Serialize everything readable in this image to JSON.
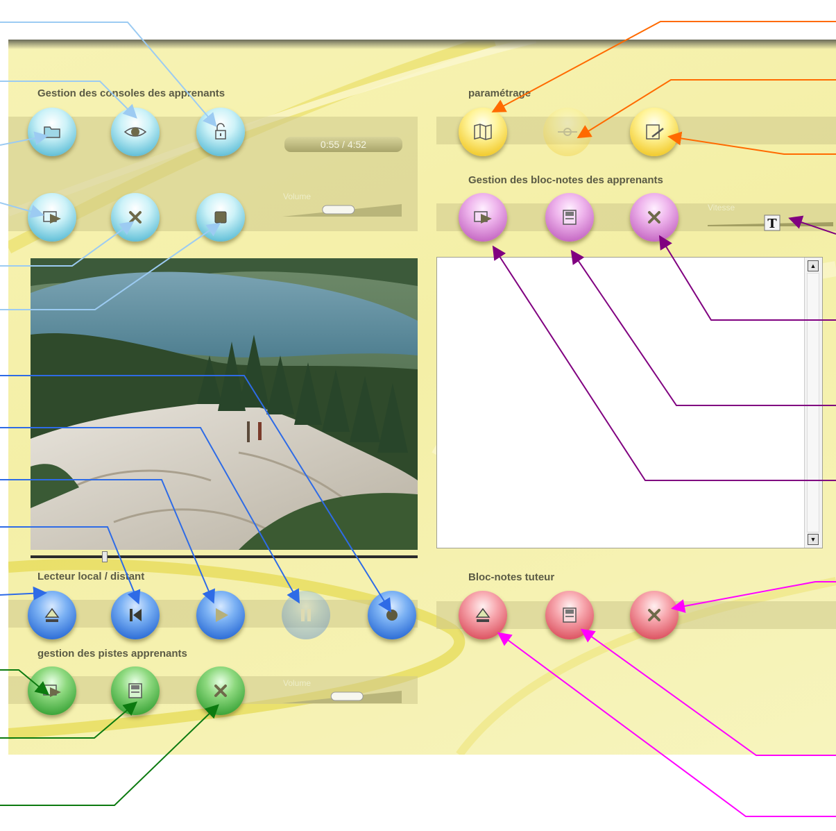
{
  "sections": {
    "consoles_title": "Gestion des consoles des apprenants",
    "parametrage_title": "paramétrage",
    "blocnotes_title": "Gestion des bloc-notes des apprenants",
    "lecteur_title": "Lecteur local / distant",
    "pistes_title": "gestion des pistes apprenants",
    "tuteur_title": "Bloc-notes tuteur"
  },
  "player": {
    "time_display": "0:55 / 4:52",
    "volume_label": "Volume",
    "volume_level": 0.45,
    "progress": 0.19
  },
  "pistes": {
    "volume_label": "Volume",
    "volume_level": 0.55
  },
  "blocnotes": {
    "speed_label": "Vitesse",
    "speed_level": 0.55,
    "speed_knob_glyph": "T",
    "notes_text": ""
  },
  "scrollbar": {
    "up_glyph": "▲",
    "down_glyph": "▼"
  },
  "colors": {
    "console_buttons": "#6fc6dc",
    "player_buttons": "#2f6fd7",
    "pistes_buttons": "#3da53a",
    "parametrage_buttons": "#f2cb2f",
    "blocnotes_buttons": "#c66ac4",
    "tuteur_buttons": "#dd5563",
    "callout_cyan": "#9ccbf2",
    "callout_orange": "#ff6a00",
    "callout_purple": "#800080",
    "callout_blue": "#2e6be6",
    "callout_green": "#0c7a10",
    "callout_magenta": "#ff00ff"
  },
  "icons": {
    "console": [
      "folder-icon",
      "eye-icon",
      "unlock-icon",
      "export-icon",
      "close-icon",
      "stop-icon"
    ],
    "parametrage": [
      "map-icon",
      "link-icon",
      "edit-icon"
    ],
    "blocnotes": [
      "export-icon",
      "save-icon",
      "close-icon"
    ],
    "player": [
      "eject-icon",
      "skip-back-icon",
      "play-icon",
      "pause-icon",
      "record-icon"
    ],
    "pistes": [
      "export-icon",
      "save-icon",
      "close-icon"
    ],
    "tuteur": [
      "eject-icon",
      "save-icon",
      "close-icon"
    ]
  }
}
